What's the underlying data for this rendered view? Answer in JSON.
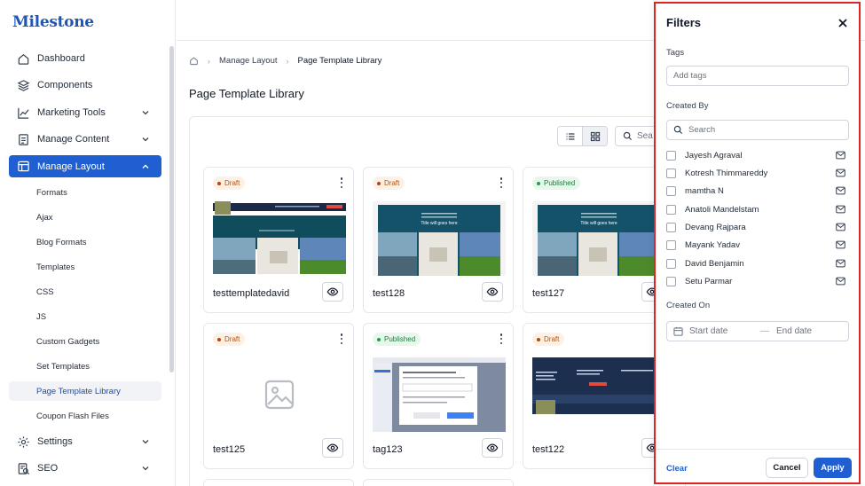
{
  "app": {
    "logo": "Milestone"
  },
  "sidebar": {
    "items": [
      {
        "label": "Dashboard",
        "icon": "home-icon"
      },
      {
        "label": "Components",
        "icon": "layers-icon"
      },
      {
        "label": "Marketing Tools",
        "icon": "chart-line-icon"
      },
      {
        "label": "Manage Content",
        "icon": "document-icon"
      },
      {
        "label": "Manage Layout",
        "icon": "layout-icon",
        "active": true
      },
      {
        "label": "Settings",
        "icon": "gear-icon"
      },
      {
        "label": "SEO",
        "icon": "seo-icon"
      }
    ],
    "sub_items": [
      "Formats",
      "Ajax",
      "Blog Formats",
      "Templates",
      "CSS",
      "JS",
      "Custom Gadgets",
      "Set Templates",
      "Page Template Library",
      "Coupon Flash Files"
    ],
    "active_sub": "Page Template Library",
    "accent_color": "#1f5fd1"
  },
  "breadcrumb": {
    "items": [
      "Manage Layout",
      "Page Template Library"
    ]
  },
  "page": {
    "title": "Page Template Library"
  },
  "toolbar": {
    "search_placeholder": "Sea"
  },
  "cards": [
    {
      "name": "testtemplatedavid",
      "status": "Draft",
      "thumb": "dark-site"
    },
    {
      "name": "test128",
      "status": "Draft",
      "thumb": "teal-site",
      "hero": "Title will goes here"
    },
    {
      "name": "test127",
      "status": "Published",
      "thumb": "teal-site",
      "hero": "Title will goes here"
    },
    {
      "name": "test125",
      "status": "Draft",
      "thumb": "placeholder"
    },
    {
      "name": "tag123",
      "status": "Published",
      "thumb": "dialog-screenshot"
    },
    {
      "name": "test122",
      "status": "Draft",
      "thumb": "navy-site"
    }
  ],
  "filters": {
    "title": "Filters",
    "tags_label": "Tags",
    "tags_placeholder": "Add tags",
    "created_by_label": "Created By",
    "search_placeholder": "Search",
    "users": [
      "Jayesh Agraval",
      "Kotresh Thimmareddy",
      "mamtha N",
      "Anatoli Mandelstam",
      "Devang Rajpara",
      "Mayank Yadav",
      "David Benjamin",
      "Setu Parmar"
    ],
    "created_on_label": "Created On",
    "start_date_placeholder": "Start date",
    "end_date_placeholder": "End date",
    "clear_label": "Clear",
    "cancel_label": "Cancel",
    "apply_label": "Apply"
  }
}
